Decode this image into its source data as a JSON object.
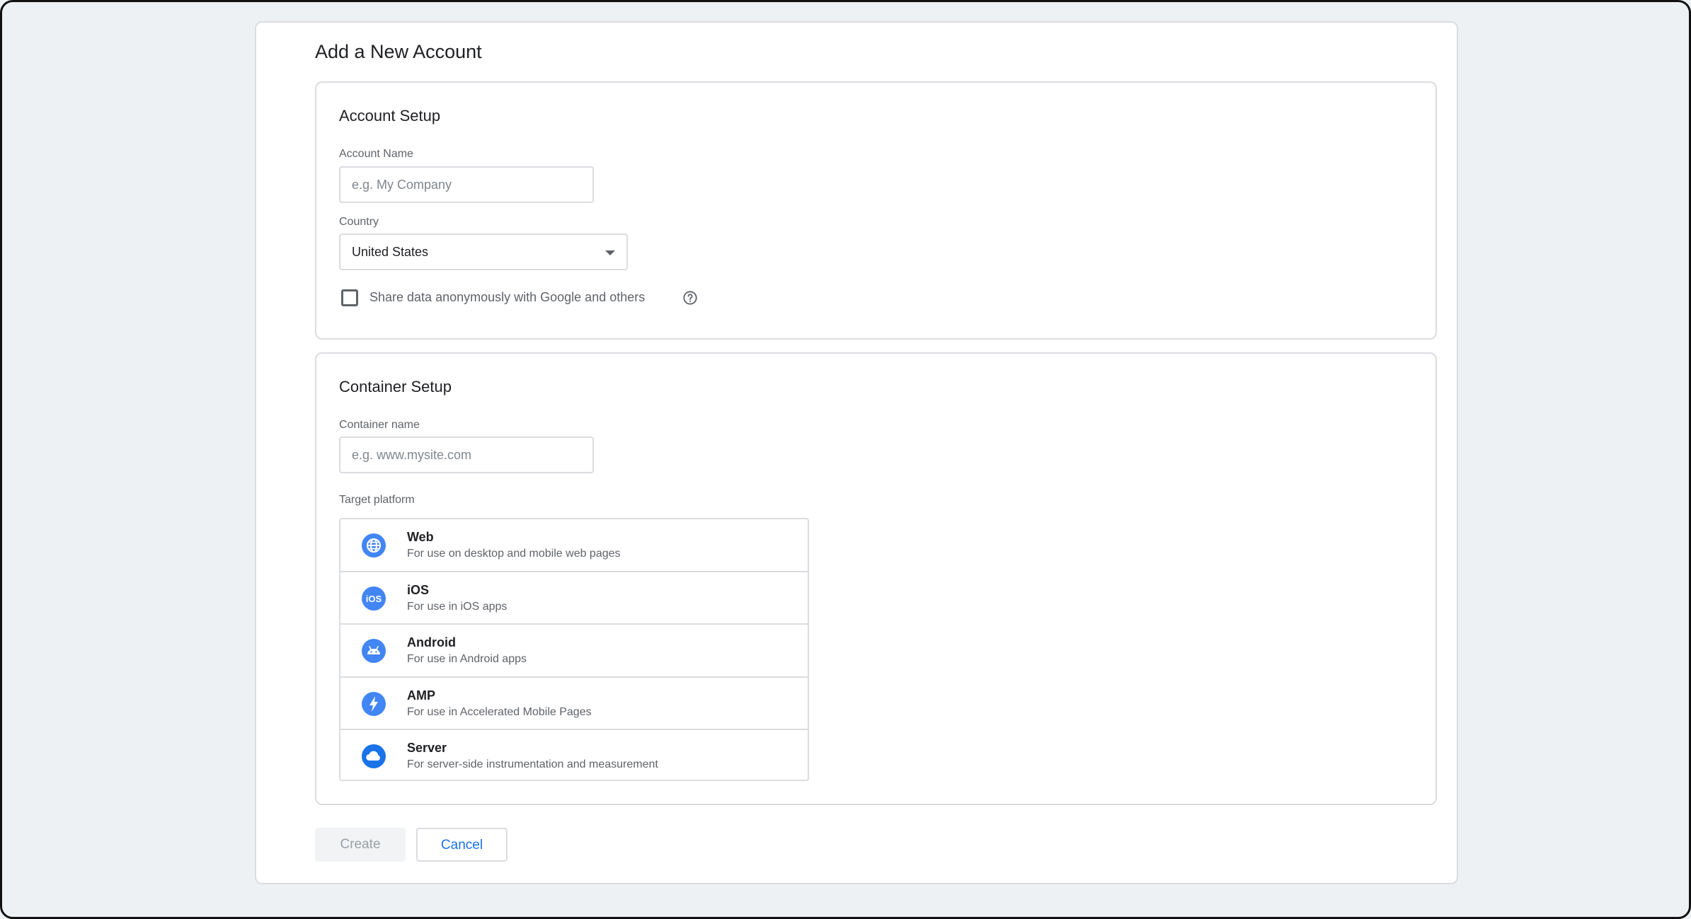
{
  "page": {
    "title": "Add a New Account"
  },
  "account_setup": {
    "title": "Account Setup",
    "account_name_label": "Account Name",
    "account_name_placeholder": "e.g. My Company",
    "country_label": "Country",
    "country_value": "United States",
    "share_data_label": "Share data anonymously with Google and others",
    "share_data_checked": false
  },
  "container_setup": {
    "title": "Container Setup",
    "container_name_label": "Container name",
    "container_name_placeholder": "e.g. www.mysite.com",
    "target_platform_label": "Target platform",
    "platforms": [
      {
        "name": "Web",
        "description": "For use on desktop and mobile web pages",
        "icon": "globe-icon"
      },
      {
        "name": "iOS",
        "description": "For use in iOS apps",
        "icon": "ios-icon"
      },
      {
        "name": "Android",
        "description": "For use in Android apps",
        "icon": "android-icon"
      },
      {
        "name": "AMP",
        "description": "For use in Accelerated Mobile Pages",
        "icon": "lightning-icon"
      },
      {
        "name": "Server",
        "description": "For server-side instrumentation and measurement",
        "icon": "cloud-icon"
      }
    ]
  },
  "actions": {
    "create_label": "Create",
    "cancel_label": "Cancel"
  },
  "colors": {
    "accent": "#1a73e8",
    "icon_blue": "#4285f4",
    "border": "#dadce0",
    "background": "#eef1f3"
  }
}
